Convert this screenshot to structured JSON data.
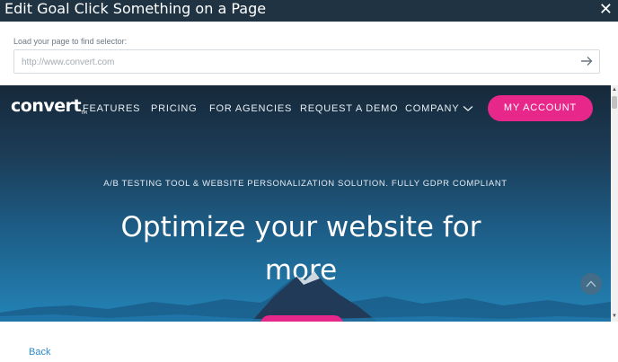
{
  "dialog": {
    "title": "Edit Goal Click Something on a Page",
    "close_label": "✕"
  },
  "loader": {
    "label": "Load your page to find selector:",
    "url_value": "",
    "url_placeholder": "http://www.convert.com"
  },
  "site": {
    "logo": "convert",
    "logo_tm": "TM",
    "nav": {
      "features": "FEATURES",
      "pricing": "PRICING",
      "agencies": "FOR AGENCIES",
      "demo": "REQUEST A DEMO",
      "company": "COMPANY",
      "account": "MY ACCOUNT"
    },
    "tagline": "A/B TESTING TOOL & WEBSITE PERSONALIZATION SOLUTION. FULLY GDPR COMPLIANT",
    "headline": "Optimize your website for more"
  },
  "footer": {
    "back_label": "Back"
  },
  "colors": {
    "titlebar": "#1f3343",
    "accent_pink": "#e8278a",
    "link_blue": "#2f8bc9"
  }
}
